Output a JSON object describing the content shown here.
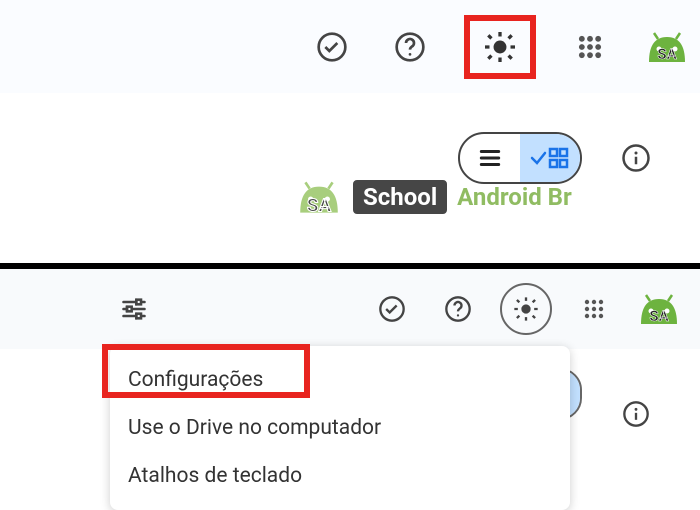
{
  "top_toolbar": {
    "ready_icon": "ready",
    "help_icon": "help",
    "settings_icon": "settings",
    "apps_icon": "apps",
    "logo_icon": "sa-logo"
  },
  "view_controls": {
    "list_icon": "list-view",
    "grid_icon": "grid-view",
    "info_icon": "info"
  },
  "watermark": {
    "sa_text": "SA",
    "school_text": "School",
    "android_text": "Android Br"
  },
  "bottom_toolbar": {
    "tune_icon": "tune",
    "ready_icon": "ready",
    "help_icon": "help",
    "settings_icon": "settings",
    "apps_icon": "apps",
    "logo_icon": "sa-logo"
  },
  "dropdown": {
    "items": [
      "Configurações",
      "Use o Drive no computador",
      "Atalhos de teclado"
    ]
  }
}
